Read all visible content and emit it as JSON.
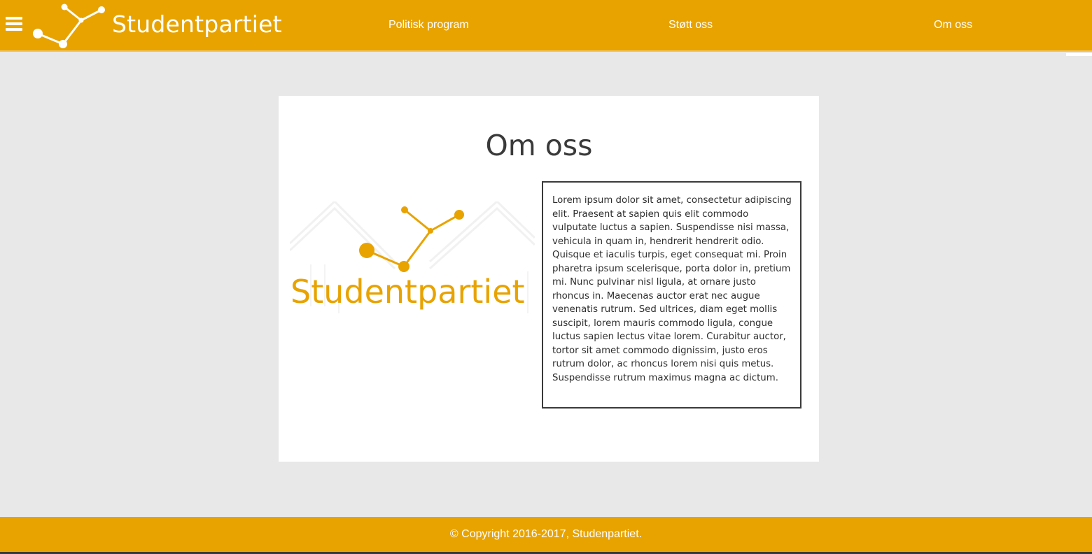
{
  "header": {
    "brand": "Studentpartiet",
    "menu_icon": "hamburger-menu-icon",
    "nav": [
      {
        "label": "Politisk program"
      },
      {
        "label": "Støtt oss"
      },
      {
        "label": "Om oss"
      }
    ]
  },
  "main": {
    "title": "Om oss",
    "logo_text": "Studentpartiet",
    "body": "Lorem ipsum dolor sit amet, consectetur adipiscing elit. Praesent at sapien quis elit commodo vulputate luctus a sapien. Suspendisse nisi massa, vehicula in quam in, hendrerit hendrerit odio. Quisque et iaculis turpis, eget consequat mi. Proin pharetra ipsum scelerisque, porta dolor in, pretium mi. Nunc pulvinar nisl ligula, at ornare justo rhoncus in. Maecenas auctor erat nec augue venenatis rutrum. Sed ultrices, diam eget mollis suscipit, lorem mauris commodo ligula, congue luctus sapien lectus vitae lorem. Curabitur auctor, tortor sit amet commodo dignissim, justo eros rutrum dolor, ac rhoncus lorem nisi quis metus. Suspendisse rutrum maximus magna ac dictum."
  },
  "footer": {
    "copyright": "© Copyright 2016-2017, Studenpartiet."
  },
  "colors": {
    "brand": "#e8a300",
    "background": "#e8e8e8",
    "card": "#ffffff",
    "text": "#3a3a3a"
  }
}
